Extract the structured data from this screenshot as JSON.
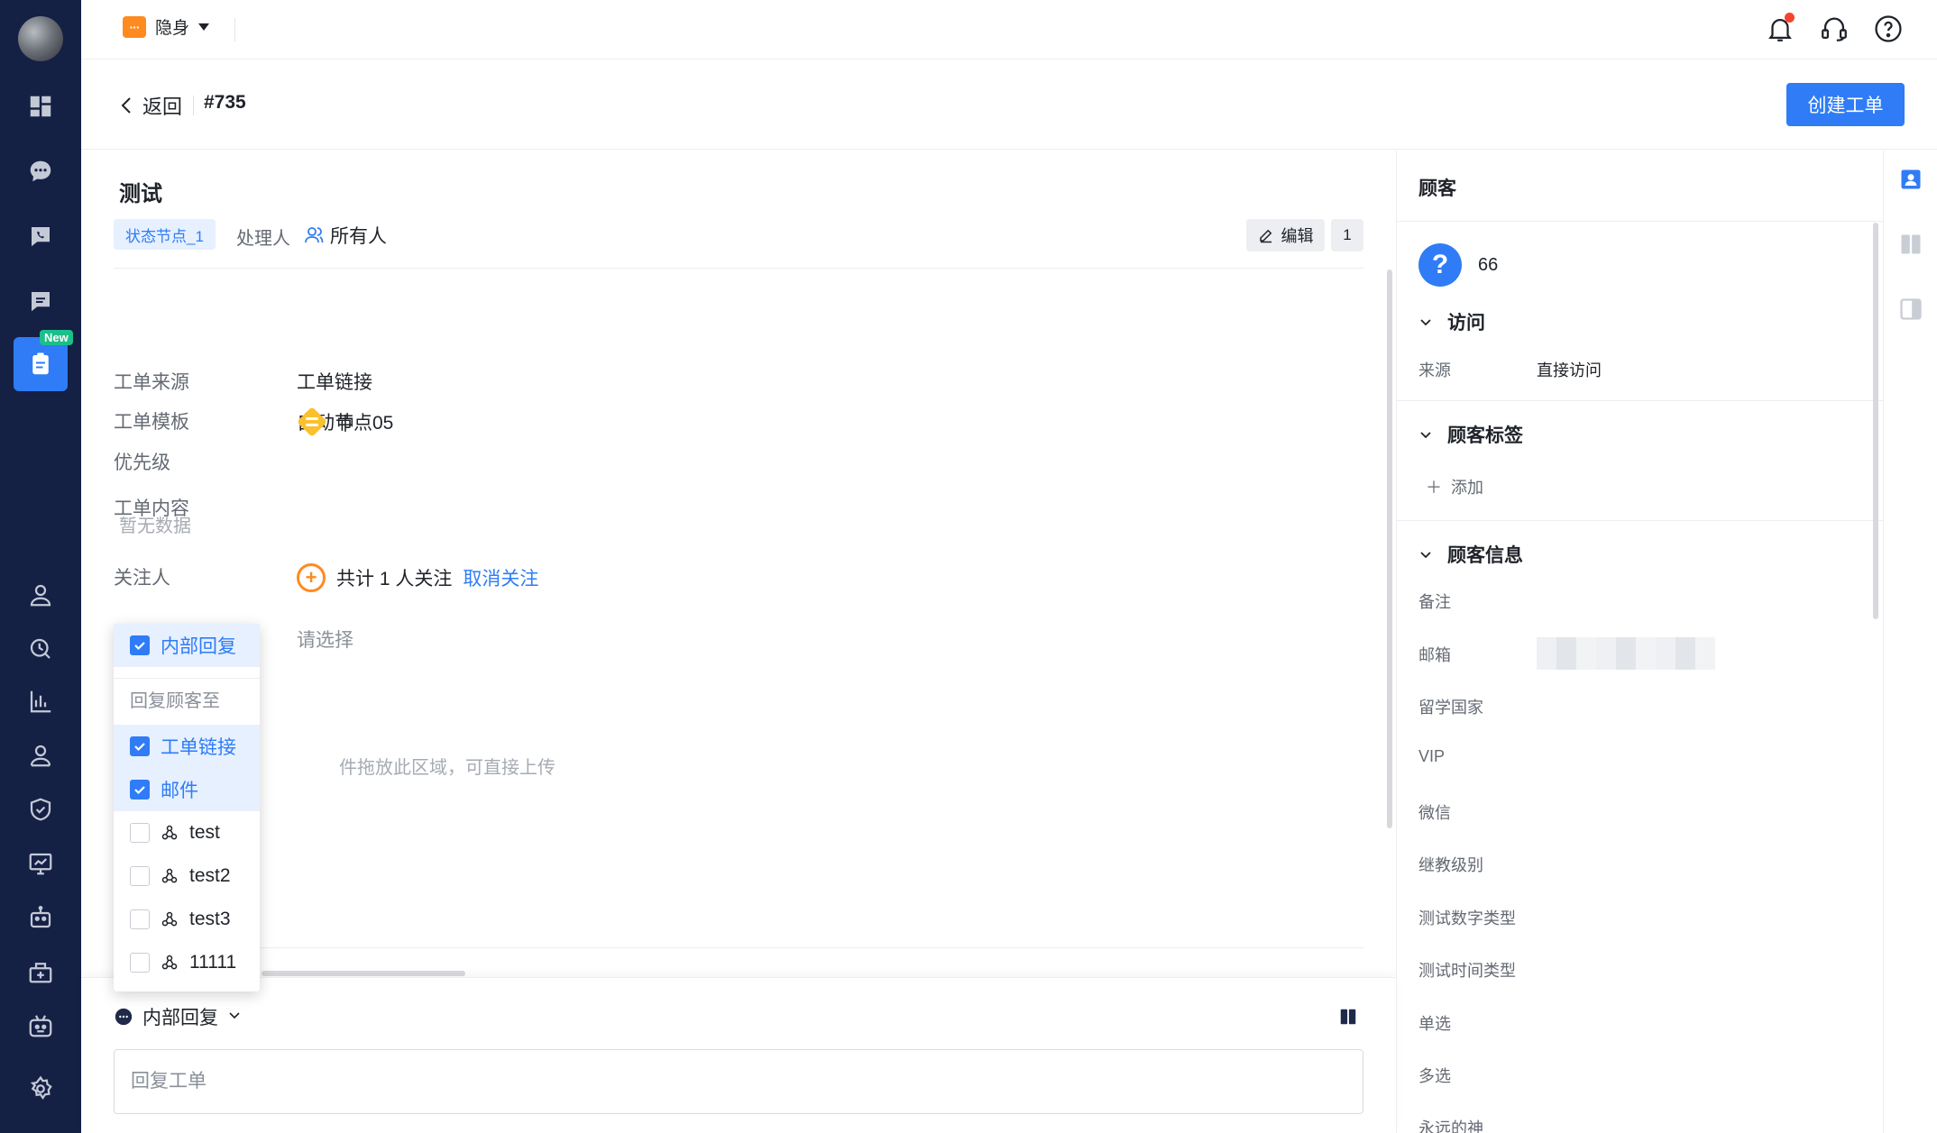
{
  "topbar": {
    "status_label": "隐身",
    "icons": [
      "bell-icon",
      "headset-icon",
      "help-icon"
    ]
  },
  "header": {
    "back_label": "返回",
    "ticket_number": "#735",
    "create_button": "创建工单"
  },
  "sidebar": {
    "new_badge": "New",
    "items": [
      "dashboard-icon",
      "chat-icon",
      "phone-icon",
      "message-icon",
      "ticket-icon",
      "user-icon",
      "search-time-icon",
      "bar-chart-icon",
      "team-icon",
      "shield-icon",
      "monitor-icon",
      "robot-icon",
      "apps-icon",
      "bot-icon",
      "settings-icon"
    ]
  },
  "ticket": {
    "title": "测试",
    "state_tag": "状态节点_1",
    "handler_label": "处理人",
    "handler_value": "所有人",
    "edit_label": "编辑",
    "count": "1",
    "fields": {
      "source_label": "工单来源",
      "source_value": "工单链接",
      "template_label": "工单模板",
      "template_value": "自动节点05",
      "priority_label": "优先级",
      "priority_value": "中",
      "content_label": "工单内容",
      "content_empty": "暂无数据",
      "followers_label": "关注人",
      "followers_text": "共计 1 人关注",
      "unfollow_label": "取消关注",
      "select_placeholder": "请选择",
      "upload_hint": "件拖放此区域，可直接上传"
    }
  },
  "dropdown": {
    "internal_reply": "内部回复",
    "reply_to_header": "回复顾客至",
    "options": [
      {
        "label": "工单链接",
        "checked": true
      },
      {
        "label": "邮件",
        "checked": true
      },
      {
        "label": "test",
        "checked": false
      },
      {
        "label": "test2",
        "checked": false
      },
      {
        "label": "test3",
        "checked": false
      },
      {
        "label": "11111",
        "checked": false
      }
    ]
  },
  "reply": {
    "mode_label": "内部回复",
    "placeholder": "回复工单"
  },
  "customer_panel": {
    "title": "顾客",
    "customer_name": "66",
    "visit_section": "访问",
    "source_label": "来源",
    "source_value": "直接访问",
    "tags_section": "顾客标签",
    "add_label": "添加",
    "info_section": "顾客信息",
    "info_fields": [
      "备注",
      "邮箱",
      "留学国家",
      "VIP",
      "微信",
      "继教级别",
      "测试数字类型",
      "测试时间类型",
      "单选",
      "多选",
      "永远的神"
    ]
  },
  "colors": {
    "accent": "#2f7cf6",
    "sidebar_bg": "#152045",
    "warning": "#ff8a1f",
    "priority_medium": "#fbc02d",
    "new_badge": "#1bbf8a"
  }
}
